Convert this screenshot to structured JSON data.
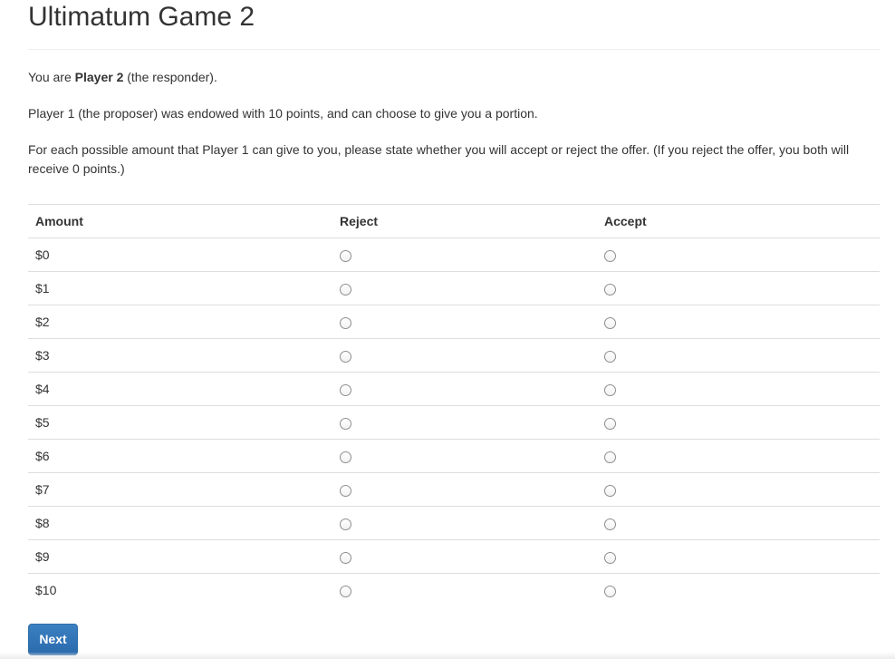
{
  "page": {
    "title": "Ultimatum Game 2"
  },
  "intro": {
    "role_prefix": "You are ",
    "role_strong": "Player 2",
    "role_suffix": " (the responder).",
    "endowment": "Player 1 (the proposer) was endowed with 10 points, and can choose to give you a portion.",
    "instructions": "For each possible amount that Player 1 can give to you, please state whether you will accept or reject the offer. (If you reject the offer, you both will receive 0 points.)"
  },
  "table": {
    "headers": [
      "Amount",
      "Reject",
      "Accept"
    ],
    "rows": [
      {
        "amount": "$0",
        "selected": null
      },
      {
        "amount": "$1",
        "selected": null
      },
      {
        "amount": "$2",
        "selected": null
      },
      {
        "amount": "$3",
        "selected": null
      },
      {
        "amount": "$4",
        "selected": null
      },
      {
        "amount": "$5",
        "selected": null
      },
      {
        "amount": "$6",
        "selected": null
      },
      {
        "amount": "$7",
        "selected": null
      },
      {
        "amount": "$8",
        "selected": null
      },
      {
        "amount": "$9",
        "selected": null
      },
      {
        "amount": "$10",
        "selected": null
      }
    ]
  },
  "actions": {
    "next_label": "Next"
  },
  "colors": {
    "primary_button": "#337ab7",
    "rule": "#dddddd",
    "text": "#333333"
  }
}
